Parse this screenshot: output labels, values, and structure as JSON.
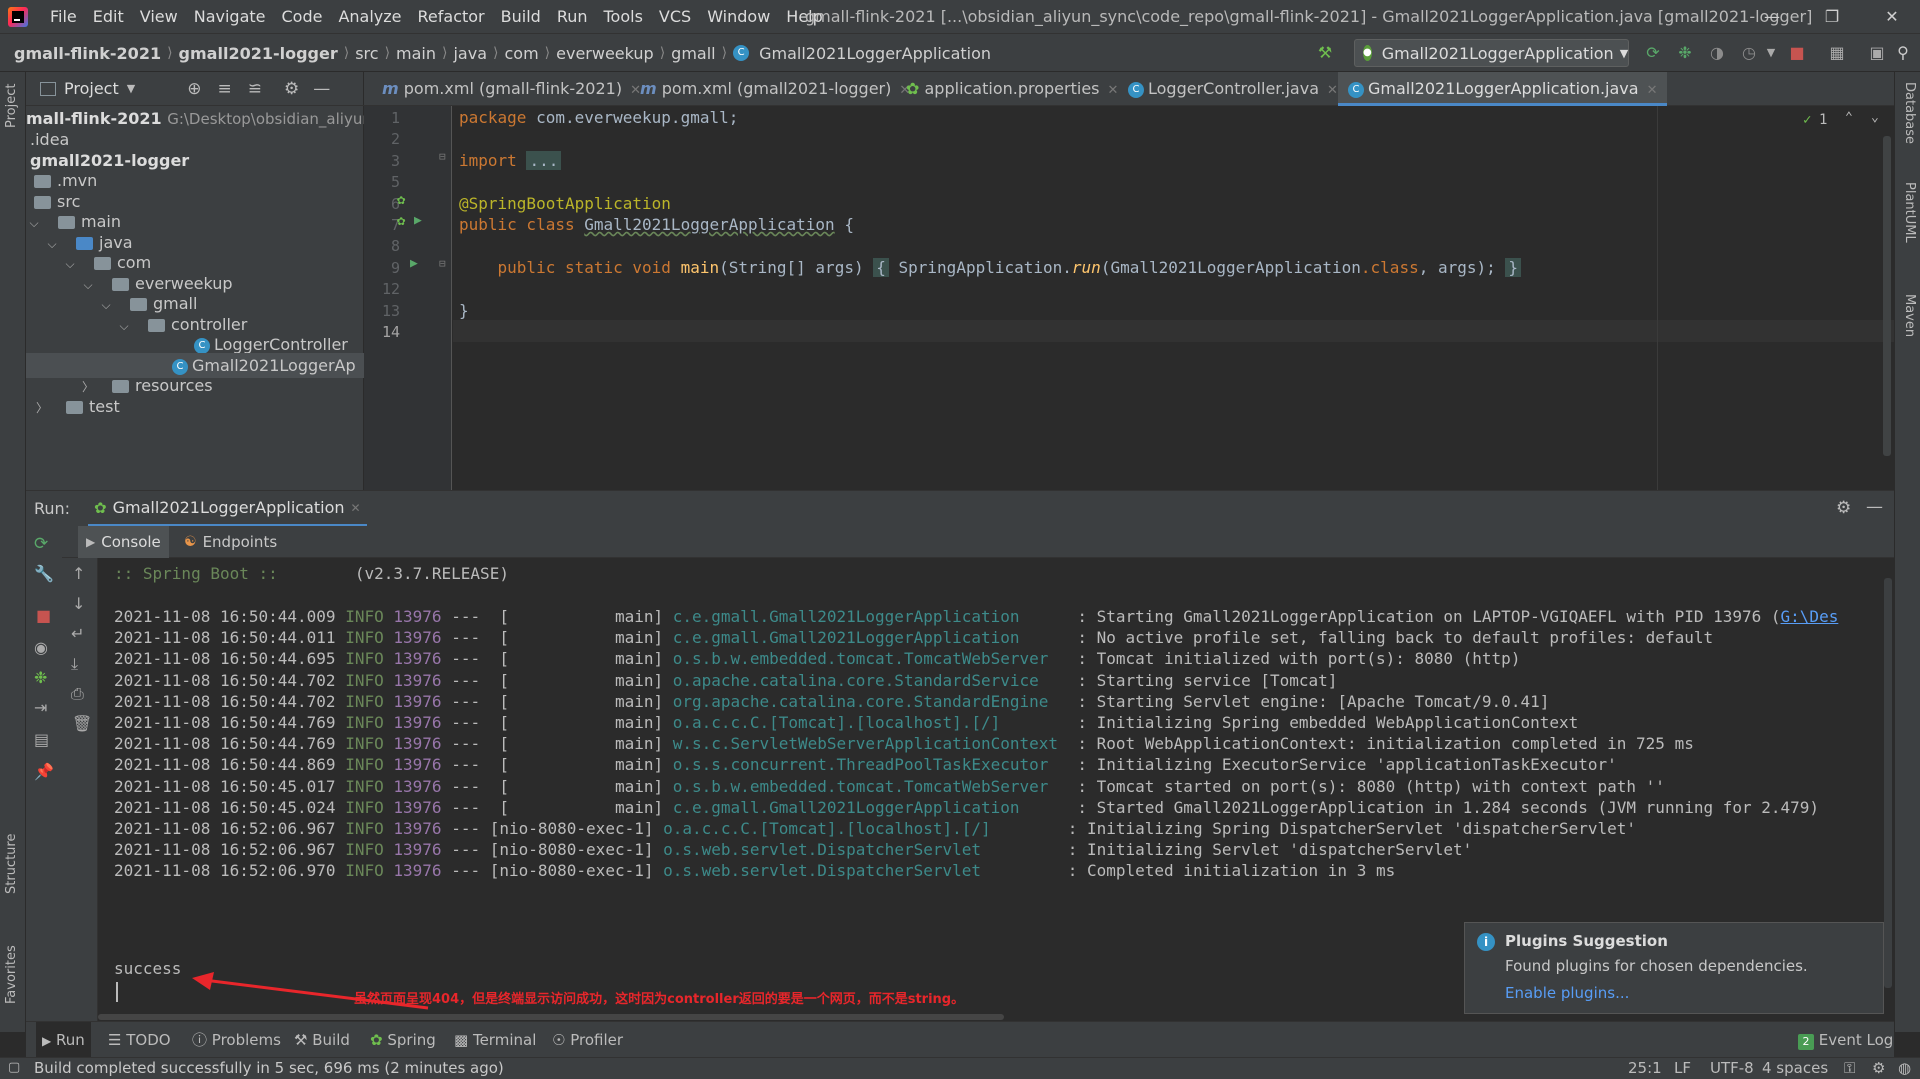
{
  "app": {
    "title": "gmall-flink-2021 [...\\obsidian_aliyun_sync\\code_repo\\gmall-flink-2021] - Gmall2021LoggerApplication.java [gmall2021-logger]",
    "menu": [
      "File",
      "Edit",
      "View",
      "Navigate",
      "Code",
      "Analyze",
      "Refactor",
      "Build",
      "Run",
      "Tools",
      "VCS",
      "Window",
      "Help"
    ]
  },
  "breadcrumbs": [
    "gmall-flink-2021",
    "gmall2021-logger",
    "src",
    "main",
    "java",
    "com",
    "everweekup",
    "gmall",
    "Gmall2021LoggerApplication"
  ],
  "run_config": "Gmall2021LoggerApplication",
  "project_panel": {
    "title": "Project",
    "root_label": "mall-flink-2021",
    "root_path": "G:\\Desktop\\obsidian_aliyun_sy",
    "tree": [
      {
        "label": ".idea"
      },
      {
        "label": "gmall2021-logger"
      },
      {
        "label": ".mvn"
      },
      {
        "label": "src"
      },
      {
        "label": "main"
      },
      {
        "label": "java"
      },
      {
        "label": "com"
      },
      {
        "label": "everweekup"
      },
      {
        "label": "gmall"
      },
      {
        "label": "controller"
      },
      {
        "label": "LoggerController"
      },
      {
        "label": "Gmall2021LoggerAp"
      },
      {
        "label": "resources"
      },
      {
        "label": "test"
      }
    ]
  },
  "editor_tabs": [
    {
      "label": "pom.xml (gmall-flink-2021)"
    },
    {
      "label": "pom.xml (gmall2021-logger)"
    },
    {
      "label": "application.properties"
    },
    {
      "label": "LoggerController.java"
    },
    {
      "label": "Gmall2021LoggerApplication.java",
      "active": true
    }
  ],
  "editor": {
    "line_numbers": [
      "1",
      "2",
      "3",
      "5",
      "6",
      "7",
      "8",
      "9",
      "12",
      "13",
      "14"
    ],
    "inspection_count": "1",
    "code": {
      "package_kw": "package",
      "package_name": " com.everweekup.gmall;",
      "import_kw": "import",
      "import_fold": "...",
      "annotation": "@SpringBootApplication",
      "class_kw": "public class",
      "class_name": "Gmall2021LoggerApplication",
      "class_open": " {",
      "method_kw": "public static void",
      "method_name": "main",
      "method_params": "(String[] args)",
      "body_open": "{",
      "body_call_class": "SpringApplication.",
      "body_call_fn": "run",
      "body_arg_class": "(Gmall2021LoggerApplication",
      "body_arg_kw": ".class",
      "body_args_end": ", args);",
      "body_close": "}",
      "class_close": "}"
    }
  },
  "run_panel": {
    "label": "Run:",
    "tab": "Gmall2021LoggerApplication",
    "subtabs": [
      "Console",
      "Endpoints"
    ],
    "banner": ":: Spring Boot ::",
    "banner_version": "(v2.3.7.RELEASE)",
    "logs": [
      {
        "ts": "2021-11-08 16:50:44.009",
        "lvl": "INFO",
        "pid": "13976",
        "thread": "---  [           main]",
        "logger": "c.e.gmall.Gmall2021LoggerApplication    ",
        "msg": " : Starting Gmall2021LoggerApplication on LAPTOP-VGIQAEFL with PID 13976 (",
        "link": "G:\\Des"
      },
      {
        "ts": "2021-11-08 16:50:44.011",
        "lvl": "INFO",
        "pid": "13976",
        "thread": "---  [           main]",
        "logger": "c.e.gmall.Gmall2021LoggerApplication    ",
        "msg": " : No active profile set, falling back to default profiles: default"
      },
      {
        "ts": "2021-11-08 16:50:44.695",
        "lvl": "INFO",
        "pid": "13976",
        "thread": "---  [           main]",
        "logger": "o.s.b.w.embedded.tomcat.TomcatWebServer ",
        "msg": " : Tomcat initialized with port(s): 8080 (http)"
      },
      {
        "ts": "2021-11-08 16:50:44.702",
        "lvl": "INFO",
        "pid": "13976",
        "thread": "---  [           main]",
        "logger": "o.apache.catalina.core.StandardService  ",
        "msg": " : Starting service [Tomcat]"
      },
      {
        "ts": "2021-11-08 16:50:44.702",
        "lvl": "INFO",
        "pid": "13976",
        "thread": "---  [           main]",
        "logger": "org.apache.catalina.core.StandardEngine ",
        "msg": " : Starting Servlet engine: [Apache Tomcat/9.0.41]"
      },
      {
        "ts": "2021-11-08 16:50:44.769",
        "lvl": "INFO",
        "pid": "13976",
        "thread": "---  [           main]",
        "logger": "o.a.c.c.C.[Tomcat].[localhost].[/]      ",
        "msg": " : Initializing Spring embedded WebApplicationContext"
      },
      {
        "ts": "2021-11-08 16:50:44.769",
        "lvl": "INFO",
        "pid": "13976",
        "thread": "---  [           main]",
        "logger": "w.s.c.ServletWebServerApplicationContext",
        "msg": " : Root WebApplicationContext: initialization completed in 725 ms"
      },
      {
        "ts": "2021-11-08 16:50:44.869",
        "lvl": "INFO",
        "pid": "13976",
        "thread": "---  [           main]",
        "logger": "o.s.s.concurrent.ThreadPoolTaskExecutor ",
        "msg": " : Initializing ExecutorService 'applicationTaskExecutor'"
      },
      {
        "ts": "2021-11-08 16:50:45.017",
        "lvl": "INFO",
        "pid": "13976",
        "thread": "---  [           main]",
        "logger": "o.s.b.w.embedded.tomcat.TomcatWebServer ",
        "msg": " : Tomcat started on port(s): 8080 (http) with context path ''"
      },
      {
        "ts": "2021-11-08 16:50:45.024",
        "lvl": "INFO",
        "pid": "13976",
        "thread": "---  [           main]",
        "logger": "c.e.gmall.Gmall2021LoggerApplication    ",
        "msg": " : Started Gmall2021LoggerApplication in 1.284 seconds (JVM running for 2.479)"
      },
      {
        "ts": "2021-11-08 16:52:06.967",
        "lvl": "INFO",
        "pid": "13976",
        "thread": "--- [nio-8080-exec-1]",
        "logger": "o.a.c.c.C.[Tomcat].[localhost].[/]      ",
        "msg": " : Initializing Spring DispatcherServlet 'dispatcherServlet'"
      },
      {
        "ts": "2021-11-08 16:52:06.967",
        "lvl": "INFO",
        "pid": "13976",
        "thread": "--- [nio-8080-exec-1]",
        "logger": "o.s.web.servlet.DispatcherServlet       ",
        "msg": " : Initializing Servlet 'dispatcherServlet'"
      },
      {
        "ts": "2021-11-08 16:52:06.970",
        "lvl": "INFO",
        "pid": "13976",
        "thread": "--- [nio-8080-exec-1]",
        "logger": "o.s.web.servlet.DispatcherServlet       ",
        "msg": " : Completed initialization in 3 ms"
      }
    ],
    "success_line": "success",
    "annotation_note": "虽然页面呈现404，但是终端显示访问成功，这时因为controller返回的要是一个网页，而不是string。"
  },
  "notification": {
    "title": "Plugins Suggestion",
    "body": "Found plugins for chosen dependencies.",
    "link": "Enable plugins..."
  },
  "bottom_tools": [
    "Run",
    "TODO",
    "Problems",
    "Build",
    "Spring",
    "Terminal",
    "Profiler"
  ],
  "event_log": {
    "count": "2",
    "label": "Event Log"
  },
  "left_stripe": [
    "Project",
    "Structure",
    "Favorites"
  ],
  "right_stripe": [
    "Database",
    "PlantUML",
    "Maven"
  ],
  "status": {
    "message": "Build completed successfully in 5 sec, 696 ms (2 minutes ago)",
    "position": "25:1",
    "line_sep": "LF",
    "encoding": "UTF-8",
    "indent": "4 spaces"
  },
  "colors": {
    "accent": "#4a88c7",
    "annotation_red": "#e8262b",
    "keyword": "#cc7832",
    "info_green": "#6a8759"
  }
}
